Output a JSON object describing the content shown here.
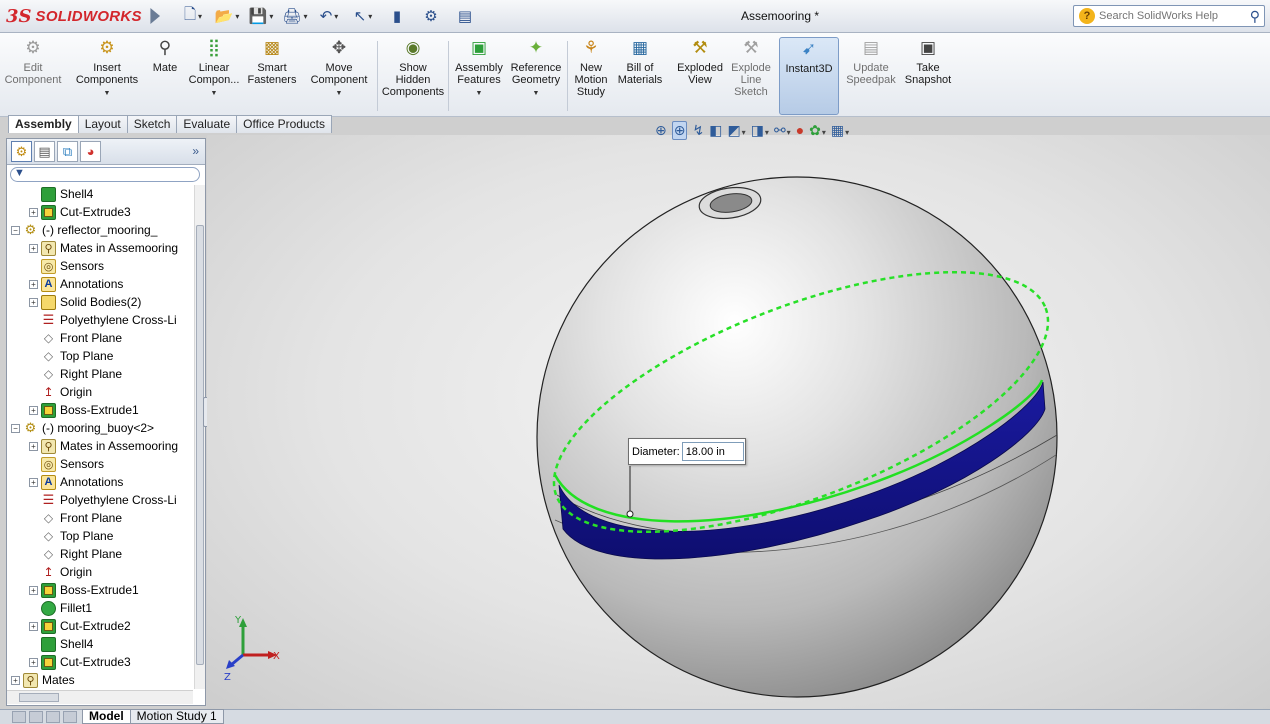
{
  "app": {
    "logo_ds": "3S",
    "logo_text": "SOLIDWORKS",
    "doc_title": "Assemooring *",
    "help_search_placeholder": "Search SolidWorks Help"
  },
  "quick_access": [
    {
      "icon": "new-document-icon",
      "glyph": "🗋"
    },
    {
      "icon": "open-folder-icon",
      "glyph": "📂"
    },
    {
      "icon": "save-icon",
      "glyph": "💾"
    },
    {
      "icon": "print-icon",
      "glyph": "🖨"
    },
    {
      "icon": "undo-icon",
      "glyph": "↶"
    },
    {
      "icon": "select-pointer-icon",
      "glyph": "↖"
    },
    {
      "icon": "rebuild-icon",
      "glyph": "▮"
    },
    {
      "icon": "options-icon",
      "glyph": "⚙"
    },
    {
      "icon": "file-properties-icon",
      "glyph": "▤"
    }
  ],
  "commands": {
    "edit_component": "Edit\nComponent",
    "insert_components": "Insert\nComponents",
    "mate": "Mate",
    "linear_component": "Linear\nCompon...",
    "smart_fasteners": "Smart\nFasteners",
    "move_component": "Move\nComponent",
    "show_hidden": "Show\nHidden\nComponents",
    "assembly_features": "Assembly\nFeatures",
    "reference_geometry": "Reference\nGeometry",
    "new_motion_study": "New\nMotion\nStudy",
    "bill_of_materials": "Bill of\nMaterials",
    "exploded_view": "Exploded\nView",
    "explode_line_sketch": "Explode\nLine\nSketch",
    "instant3d": "Instant3D",
    "update_speedpak": "Update\nSpeedpak",
    "take_snapshot": "Take\nSnapshot"
  },
  "tabs": [
    "Assembly",
    "Layout",
    "Sketch",
    "Evaluate",
    "Office Products"
  ],
  "tree": [
    {
      "label": "Shell4",
      "icon": "shell",
      "indent": 1,
      "pm": ""
    },
    {
      "label": "Cut-Extrude3",
      "icon": "feat",
      "indent": 1,
      "pm": "+"
    },
    {
      "label": "(-) reflector_mooring_",
      "icon": "part",
      "indent": 0,
      "pm": "−"
    },
    {
      "label": "Mates in Assemooring",
      "icon": "mates",
      "indent": 1,
      "pm": "+"
    },
    {
      "label": "Sensors",
      "icon": "sensor",
      "indent": 1,
      "pm": ""
    },
    {
      "label": "Annotations",
      "icon": "annot",
      "indent": 1,
      "pm": "+"
    },
    {
      "label": "Solid Bodies(2)",
      "icon": "solid",
      "indent": 1,
      "pm": "+"
    },
    {
      "label": "Polyethylene Cross-Li",
      "icon": "material",
      "indent": 1,
      "pm": ""
    },
    {
      "label": "Front Plane",
      "icon": "plane",
      "indent": 1,
      "pm": ""
    },
    {
      "label": "Top Plane",
      "icon": "plane",
      "indent": 1,
      "pm": ""
    },
    {
      "label": "Right Plane",
      "icon": "plane",
      "indent": 1,
      "pm": ""
    },
    {
      "label": "Origin",
      "icon": "origin",
      "indent": 1,
      "pm": ""
    },
    {
      "label": "Boss-Extrude1",
      "icon": "feat",
      "indent": 1,
      "pm": "+"
    },
    {
      "label": "(-) mooring_buoy<2>",
      "icon": "part",
      "indent": 0,
      "pm": "−"
    },
    {
      "label": "Mates in Assemooring",
      "icon": "mates",
      "indent": 1,
      "pm": "+"
    },
    {
      "label": "Sensors",
      "icon": "sensor",
      "indent": 1,
      "pm": ""
    },
    {
      "label": "Annotations",
      "icon": "annot",
      "indent": 1,
      "pm": "+"
    },
    {
      "label": "Polyethylene Cross-Li",
      "icon": "material",
      "indent": 1,
      "pm": ""
    },
    {
      "label": "Front Plane",
      "icon": "plane",
      "indent": 1,
      "pm": ""
    },
    {
      "label": "Top Plane",
      "icon": "plane",
      "indent": 1,
      "pm": ""
    },
    {
      "label": "Right Plane",
      "icon": "plane",
      "indent": 1,
      "pm": ""
    },
    {
      "label": "Origin",
      "icon": "origin",
      "indent": 1,
      "pm": ""
    },
    {
      "label": "Boss-Extrude1",
      "icon": "feat",
      "indent": 1,
      "pm": "+"
    },
    {
      "label": "Fillet1",
      "icon": "fillet",
      "indent": 1,
      "pm": ""
    },
    {
      "label": "Cut-Extrude2",
      "icon": "feat",
      "indent": 1,
      "pm": "+"
    },
    {
      "label": "Shell4",
      "icon": "shell",
      "indent": 1,
      "pm": ""
    },
    {
      "label": "Cut-Extrude3",
      "icon": "feat",
      "indent": 1,
      "pm": "+"
    },
    {
      "label": "Mates",
      "icon": "mates",
      "indent": 0,
      "pm": "+"
    }
  ],
  "dimension": {
    "label": "Diameter:",
    "value": "18.00 in"
  },
  "triad": {
    "x": "X",
    "y": "Y",
    "z": "Z"
  },
  "bottom_tabs": [
    "Model",
    "Motion Study 1"
  ],
  "colors": {
    "band": "#1b1b8f",
    "edge_selected": "#22e022",
    "accent": "#d3262c"
  }
}
